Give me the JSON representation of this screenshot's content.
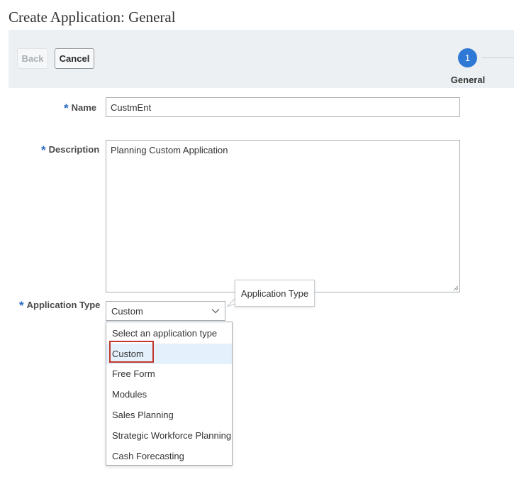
{
  "page": {
    "title": "Create Application: General"
  },
  "toolbar": {
    "back_label": "Back",
    "cancel_label": "Cancel"
  },
  "train": {
    "step_number": "1",
    "step_label": "General"
  },
  "form": {
    "required_marker": "*",
    "name": {
      "label": "Name",
      "value": "CustmEnt"
    },
    "description": {
      "label": "Description",
      "value": "Planning Custom Application"
    },
    "application_type": {
      "label": "Application Type",
      "selected": "Custom",
      "tooltip": "Application Type",
      "options": [
        "Select an application type",
        "Custom",
        "Free Form",
        "Modules",
        "Sales Planning",
        "Strategic Workforce Planning",
        "Cash Forecasting"
      ],
      "highlighted_option": "Custom"
    }
  },
  "icons": {
    "dropdown": "chevron-down-icon"
  },
  "colors": {
    "accent": "#2f79d6",
    "required": "#2b6cbf",
    "highlight_border": "#c0392b",
    "hover": "#e4f0fb"
  }
}
